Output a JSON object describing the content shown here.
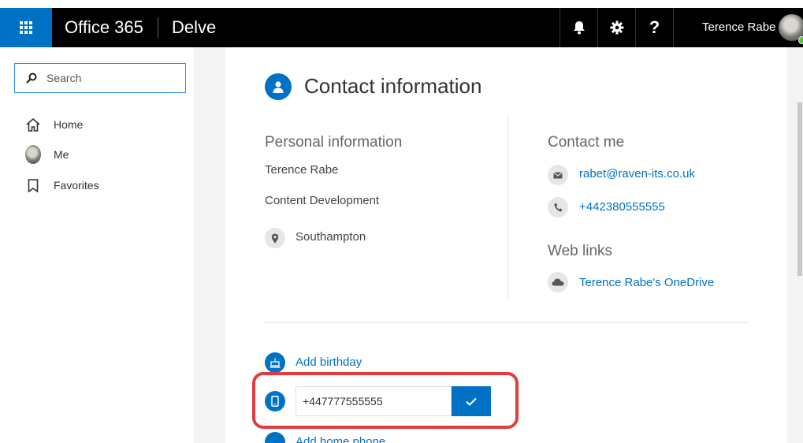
{
  "header": {
    "brand": "Office 365",
    "app_name": "Delve",
    "user_name": "Terence Rabe",
    "help_label": "?",
    "icons": [
      "app-launcher-icon",
      "bell-icon",
      "gear-icon",
      "help-icon",
      "user-avatar"
    ],
    "colors": {
      "bar": "#000000",
      "launcher": "#0072c6"
    }
  },
  "nav": {
    "search_placeholder": "Search",
    "items": [
      {
        "label": "Home",
        "icon": "home-icon"
      },
      {
        "label": "Me",
        "icon": "avatar"
      },
      {
        "label": "Favorites",
        "icon": "bookmark-icon"
      }
    ]
  },
  "card": {
    "title": "Contact information",
    "personal": {
      "heading": "Personal information",
      "name": "Terence Rabe",
      "department": "Content Development",
      "location": "Southampton"
    },
    "contact": {
      "heading": "Contact me",
      "email": "rabet@raven-its.co.uk",
      "phone": "+442380555555"
    },
    "web": {
      "heading": "Web links",
      "onedrive": "Terence Rabe's OneDrive"
    },
    "add_birthday": "Add birthday",
    "mobile_input_value": "+447777555555",
    "add_home_phone": "Add home phone",
    "accent_color": "#0072c6",
    "highlight_color": "#e23d3d"
  }
}
